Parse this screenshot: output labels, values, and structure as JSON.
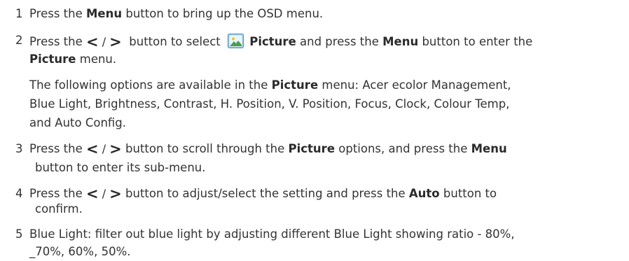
{
  "steps": [
    {
      "number": "1",
      "lines": [
        {
          "parts": [
            {
              "t": "Press the "
            },
            {
              "t": "Menu",
              "b": true
            },
            {
              "t": " button to bring up the OSD menu."
            }
          ]
        }
      ]
    },
    {
      "number": "2",
      "lines": [
        {
          "parts": [
            {
              "t": "Press the "
            },
            {
              "t": "<",
              "a": true
            },
            {
              "t": " / ",
              "s": true
            },
            {
              "t": ">",
              "a": true
            },
            {
              "t": "  button to select  "
            },
            {
              "icon": "picture-icon"
            },
            {
              "t": "Picture",
              "b": true
            },
            {
              "t": " and press the "
            },
            {
              "t": "Menu",
              "b": true
            },
            {
              "t": " button to enter the"
            }
          ]
        },
        {
          "parts": [
            {
              "t": "Picture",
              "b": true
            },
            {
              "t": " menu."
            }
          ]
        },
        {
          "parts": [
            {
              "t": "The following options are available in the "
            },
            {
              "t": "Picture",
              "b": true
            },
            {
              "t": " menu: Acer ecolor Management,"
            }
          ]
        },
        {
          "parts": [
            {
              "t": "Blue Light, Brightness, Contrast, H. Position, V. Position, Focus, Clock, Colour Temp,"
            }
          ]
        },
        {
          "parts": [
            {
              "t": "and Auto Config."
            }
          ]
        }
      ]
    },
    {
      "number": "3",
      "lines": [
        {
          "parts": [
            {
              "t": "Press the "
            },
            {
              "t": "<",
              "a": true
            },
            {
              "t": " / ",
              "s": true
            },
            {
              "t": ">",
              "a": true
            },
            {
              "t": " button to scroll through the "
            },
            {
              "t": "Picture",
              "b": true
            },
            {
              "t": " options, and press the "
            },
            {
              "t": "Menu",
              "b": true
            }
          ]
        },
        {
          "parts": [
            {
              "t": "button to enter its sub-menu."
            }
          ]
        }
      ]
    },
    {
      "number": "4",
      "lines": [
        {
          "parts": [
            {
              "t": "Press the "
            },
            {
              "t": "<",
              "a": true
            },
            {
              "t": " / ",
              "s": true
            },
            {
              "t": ">",
              "a": true
            },
            {
              "t": " button to adjust/select the setting and press the "
            },
            {
              "t": "Auto",
              "b": true
            },
            {
              "t": " button to"
            }
          ]
        },
        {
          "parts": [
            {
              "t": "confirm."
            }
          ]
        }
      ]
    },
    {
      "number": "5",
      "lines": [
        {
          "parts": [
            {
              "t": "Blue Light: filter out blue light by adjusting different Blue Light showing ratio - 80%,"
            }
          ]
        },
        {
          "parts": [
            {
              "t": "_70%, 60%, 50%."
            }
          ]
        }
      ]
    }
  ],
  "icons": {
    "picture": "picture-icon",
    "accent": "#3a8fd4"
  }
}
